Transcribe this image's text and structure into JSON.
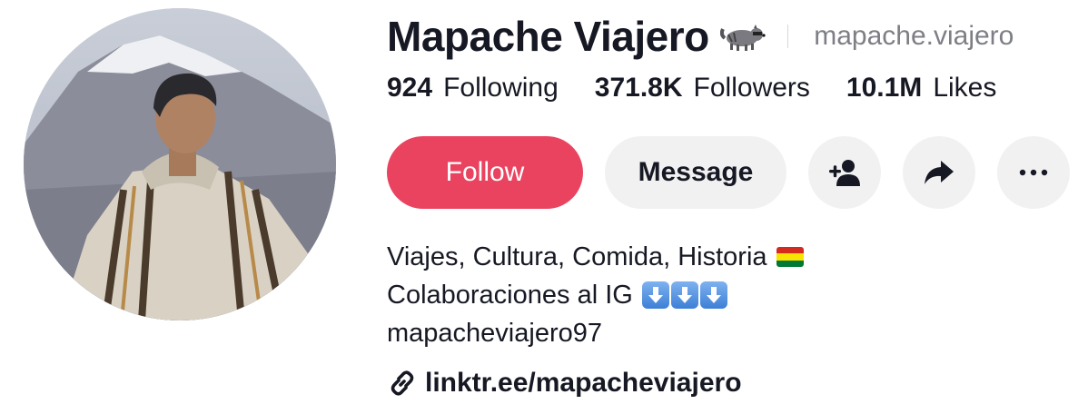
{
  "profile": {
    "display_name": "Mapache Viajero",
    "name_emoji_icon": "raccoon-emoji",
    "username": "mapache.viajero"
  },
  "stats": [
    {
      "value": "924",
      "label": "Following"
    },
    {
      "value": "371.8K",
      "label": "Followers"
    },
    {
      "value": "10.1M",
      "label": "Likes"
    }
  ],
  "actions": {
    "follow_label": "Follow",
    "message_label": "Message",
    "add_friend_icon": "add-user-icon",
    "share_icon": "share-icon",
    "more_icon": "more-icon"
  },
  "bio": {
    "line1": "Viajes, Cultura, Comida, Historia",
    "line1_emoji": "bolivia-flag",
    "line2": "Colaboraciones al IG",
    "line2_emoji": "down-arrow-emoji-x3",
    "line3": "mapacheviajero97"
  },
  "link": {
    "icon": "link-icon",
    "text": "linktr.ee/mapacheviajero"
  },
  "colors": {
    "follow_bg": "#ea4360",
    "button_bg": "#f1f1f2",
    "text": "#161823",
    "secondary_text": "#7d7f85"
  }
}
